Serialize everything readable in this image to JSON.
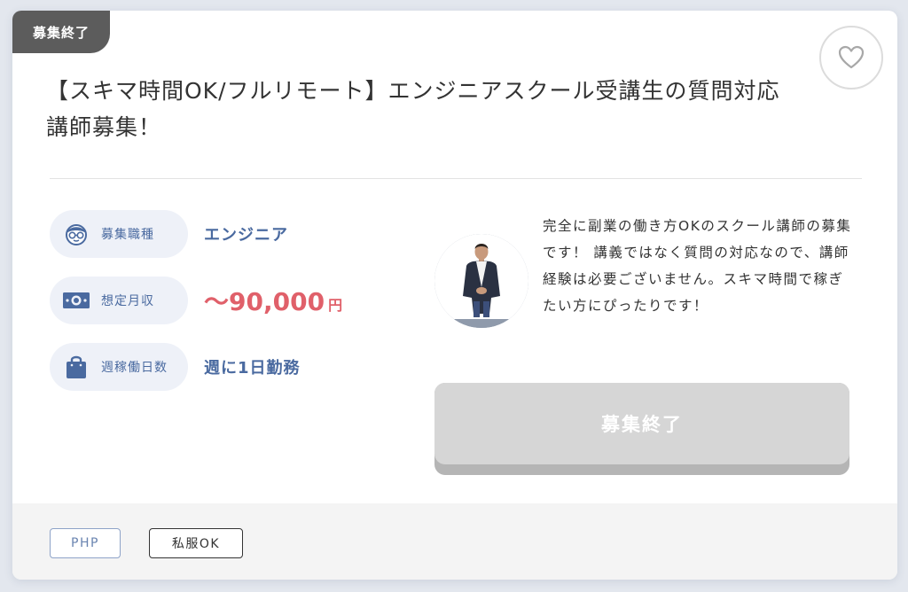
{
  "status_ribbon": "募集終了",
  "title": "【スキマ時間OK/フルリモート】エンジニアスクール受講生の質問対応講師募集！",
  "info": [
    {
      "label": "募集職種",
      "value": "エンジニア",
      "icon": "person-glasses-icon"
    },
    {
      "label": "想定月収",
      "value": "〜90,000",
      "unit": "円",
      "icon": "banknote-icon"
    },
    {
      "label": "週稼働日数",
      "value": "週に1日勤務",
      "icon": "shopping-bag-icon"
    }
  ],
  "description": "完全に副業の働き方OKのスクール講師の募集です！ 講義ではなく質問の対応なので、講師経験は必要ございません。スキマ時間で稼ぎたい方にぴったりです！",
  "apply_button": "募集終了",
  "tags": [
    "PHP",
    "私服OK"
  ],
  "colors": {
    "accent_blue": "#4a6aa0",
    "salary_red": "#e0606a",
    "ribbon": "#5c5c5c",
    "pill_bg": "#eef1f8",
    "button_disabled": "#d6d6d6"
  }
}
